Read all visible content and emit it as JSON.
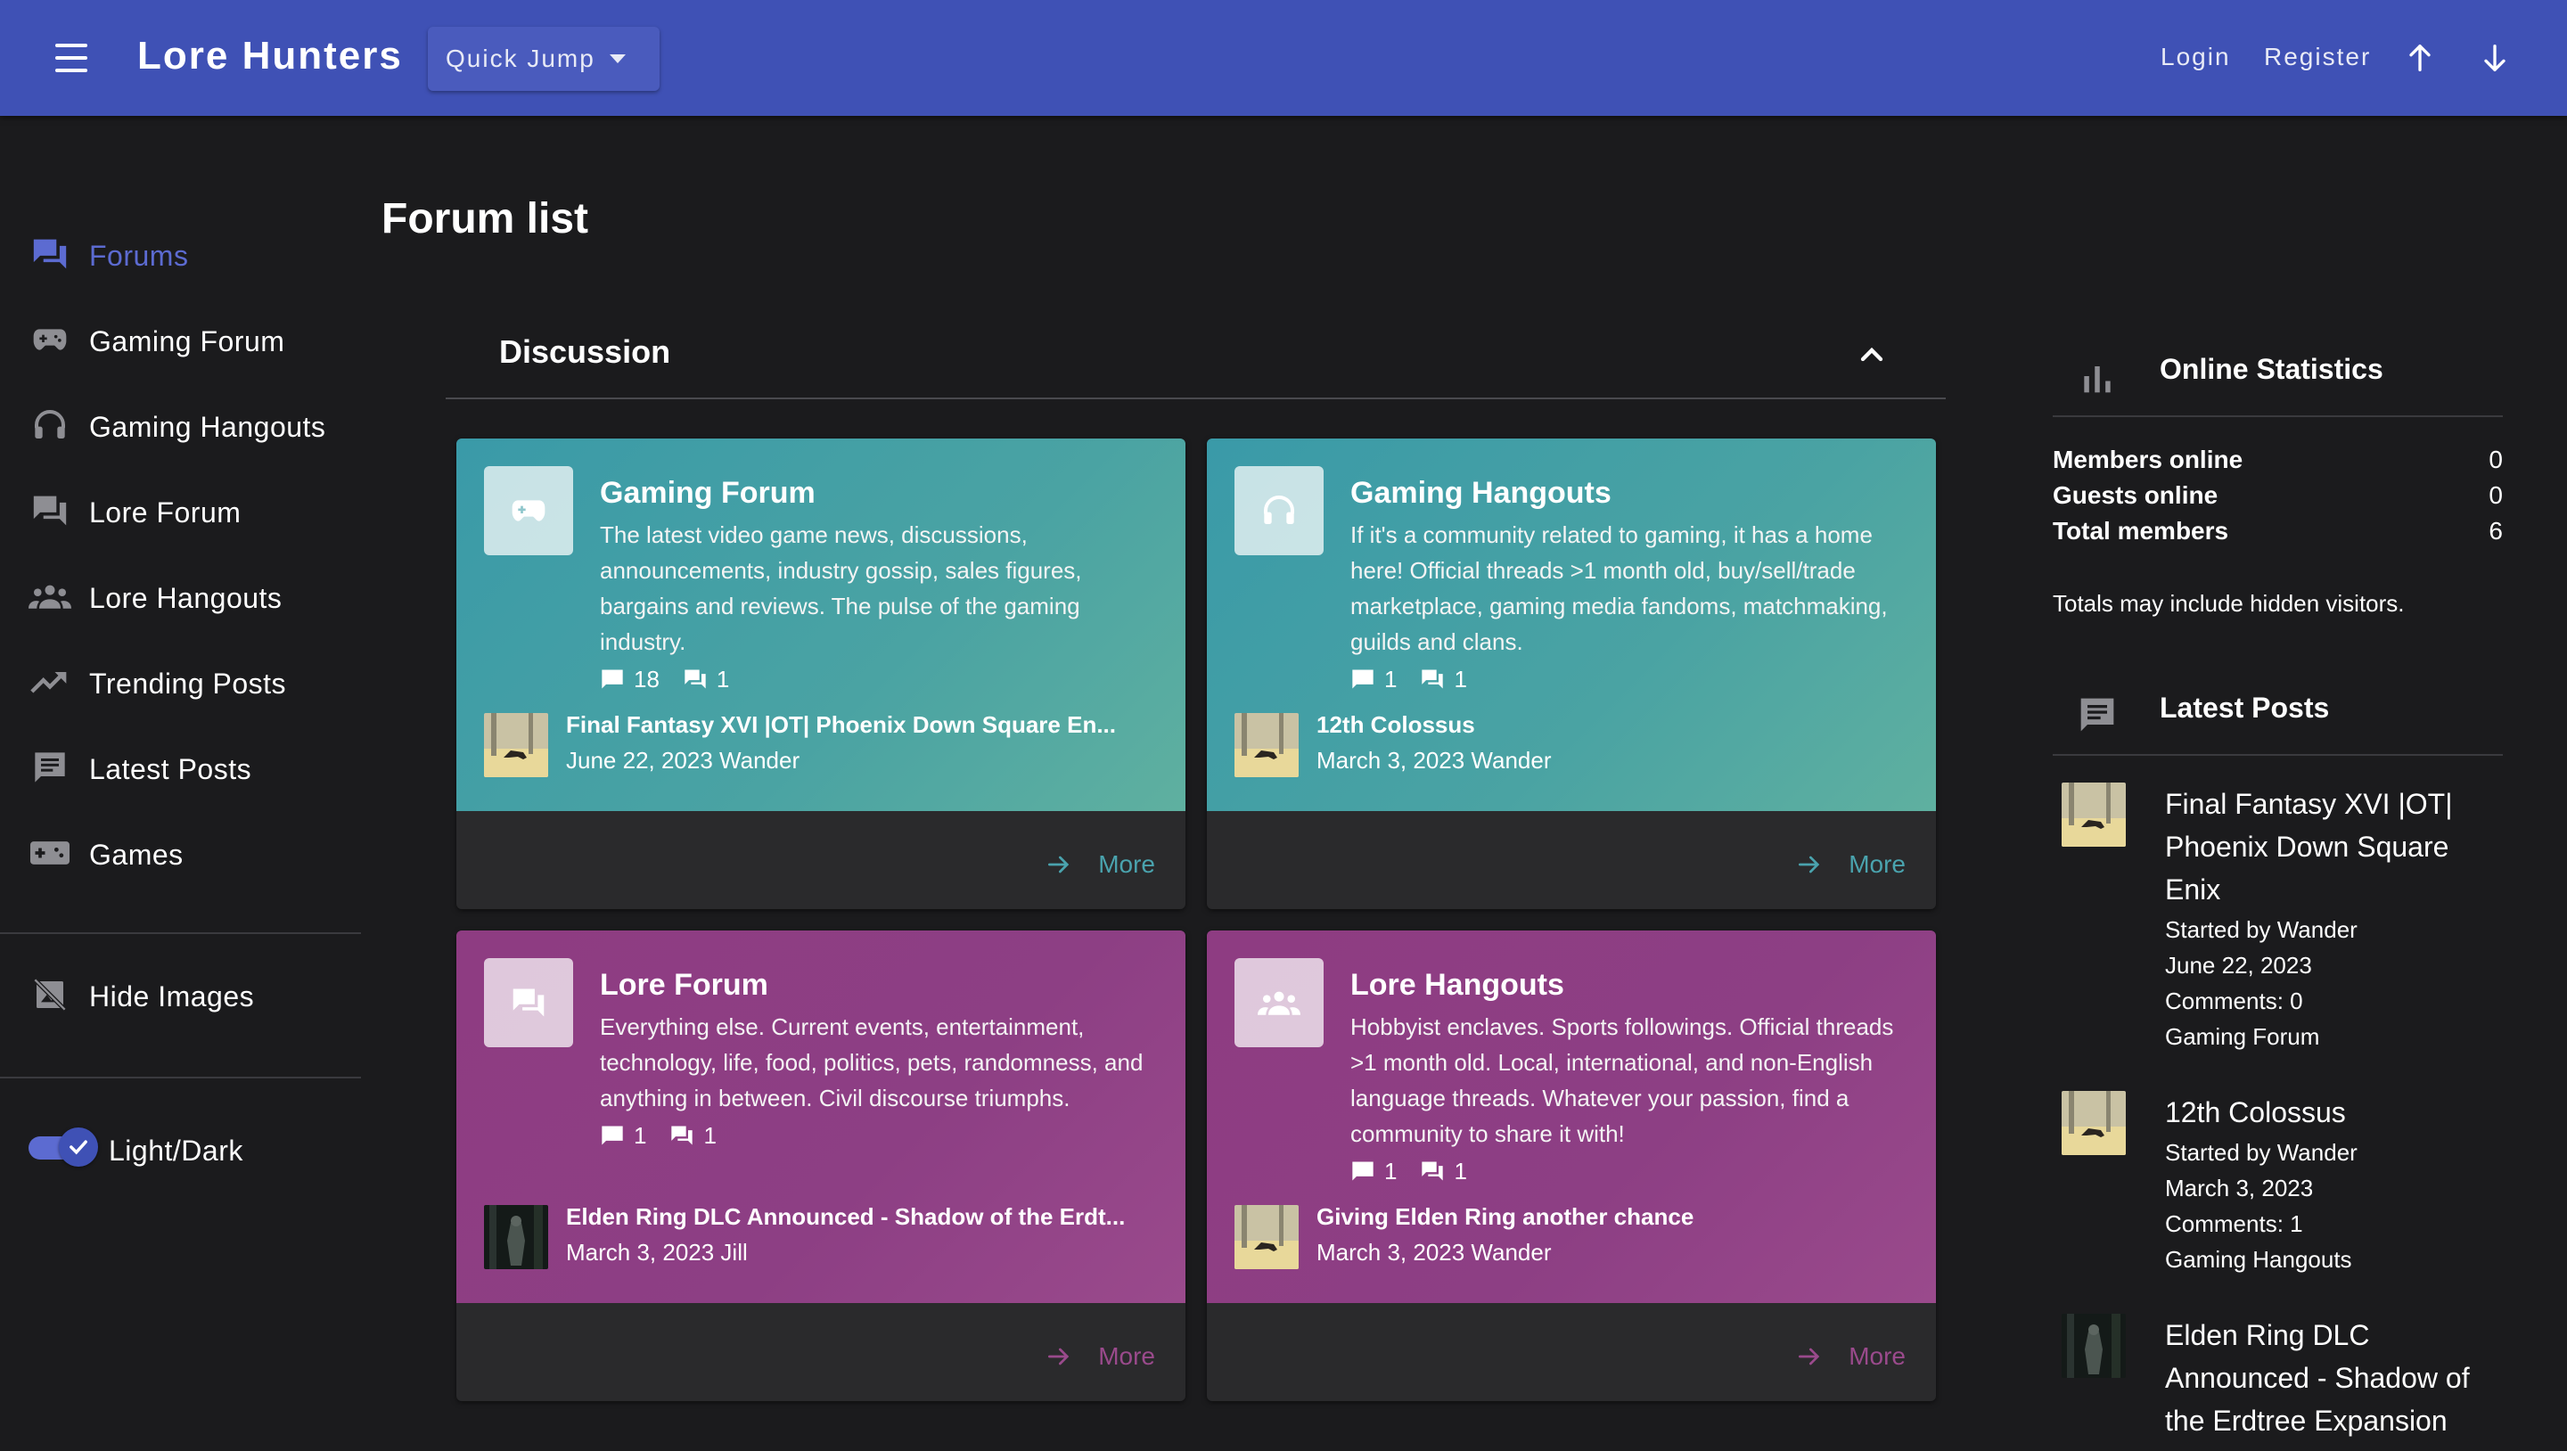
{
  "header": {
    "brand": "Lore Hunters",
    "quick_jump": "Quick Jump",
    "login": "Login",
    "register": "Register"
  },
  "sidebar": {
    "items": [
      {
        "label": "Forums",
        "icon": "forum-icon"
      },
      {
        "label": "Gaming Forum",
        "icon": "gamepad-icon"
      },
      {
        "label": "Gaming Hangouts",
        "icon": "headset-icon"
      },
      {
        "label": "Lore Forum",
        "icon": "forum-icon"
      },
      {
        "label": "Lore Hangouts",
        "icon": "group-icon"
      },
      {
        "label": "Trending Posts",
        "icon": "trending-icon"
      },
      {
        "label": "Latest Posts",
        "icon": "chat-icon"
      },
      {
        "label": "Games",
        "icon": "games-icon"
      }
    ],
    "hide_images": "Hide Images",
    "theme_toggle": "Light/Dark"
  },
  "main": {
    "title": "Forum list",
    "section": "Discussion",
    "cards": [
      {
        "title": "Gaming Forum",
        "description": "The latest video game news, discussions, announcements, industry gossip, sales figures, bargains and reviews. The pulse of the gaming industry.",
        "comments": "18",
        "threads": "1",
        "last_title": "Final Fantasy XVI |OT| Phoenix Down Square En...",
        "last_meta": "June 22, 2023 Wander",
        "more": "More"
      },
      {
        "title": "Gaming Hangouts",
        "description": "If it's a community related to gaming, it has a home here! Official threads >1 month old, buy/sell/trade marketplace, gaming media fandoms, matchmaking, guilds and clans.",
        "comments": "1",
        "threads": "1",
        "last_title": "12th Colossus",
        "last_meta": "March 3, 2023 Wander",
        "more": "More"
      },
      {
        "title": "Lore Forum",
        "description": "Everything else. Current events, entertainment, technology, life, food, politics, pets, randomness, and anything in between. Civil discourse triumphs.",
        "comments": "1",
        "threads": "1",
        "last_title": "Elden Ring DLC Announced - Shadow of the Erdt...",
        "last_meta": "March 3, 2023 Jill",
        "more": "More"
      },
      {
        "title": "Lore Hangouts",
        "description": "Hobbyist enclaves. Sports followings. Official threads >1 month old. Local, international, and non-English language threads. Whatever your passion, find a community to share it with!",
        "comments": "1",
        "threads": "1",
        "last_title": "Giving Elden Ring another chance",
        "last_meta": "March 3, 2023 Wander",
        "more": "More"
      }
    ]
  },
  "online_stats": {
    "title": "Online Statistics",
    "members_online_label": "Members online",
    "members_online": "0",
    "guests_online_label": "Guests online",
    "guests_online": "0",
    "total_members_label": "Total members",
    "total_members": "6",
    "note": "Totals may include hidden visitors."
  },
  "latest_posts": {
    "title": "Latest Posts",
    "posts": [
      {
        "title": "Final Fantasy XVI |OT| Phoenix Down Square Enix",
        "started": "Started by Wander",
        "date": "June 22, 2023",
        "comments": "Comments: 0",
        "forum": "Gaming Forum"
      },
      {
        "title": "12th Colossus",
        "started": "Started by Wander",
        "date": "March 3, 2023",
        "comments": "Comments: 1",
        "forum": "Gaming Hangouts"
      },
      {
        "title": "Elden Ring DLC Announced - Shadow of the Erdtree Expansion"
      }
    ]
  },
  "colors": {
    "primary": "#3f51b5",
    "accent_nav": "#5c6bd1",
    "teal_card": "#4aa3a3",
    "purple_card": "#8d3f84",
    "background": "#1b1b1d"
  }
}
